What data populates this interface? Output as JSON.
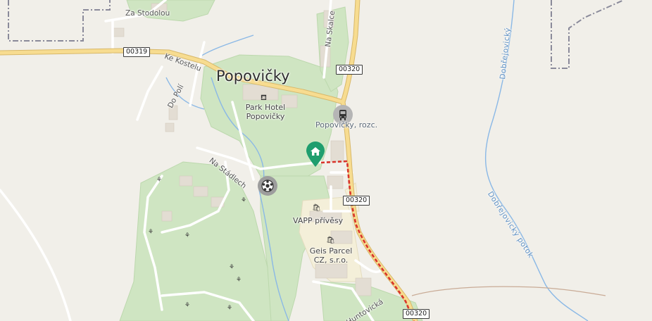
{
  "map": {
    "settlement": "Popovičky",
    "pois": {
      "hotel": "Park Hotel Popovičky",
      "bus_stop": "Popovičky, rozc.",
      "vapp": "VAPP přívěsy",
      "geis": "Geis Parcel CZ, s.r.o."
    },
    "streets": {
      "za_stodolou": "Za Stodolou",
      "ke_kostelu": "Ke Kostelu",
      "do_poli": "Do Polí",
      "na_stadlech": "Na Stádlech",
      "na_skalce": "Na Skalce",
      "huntovicka": "Huntovická"
    },
    "streams": {
      "dobrejovicky_potok": "Dobřejovický potok",
      "dobrejovicky_top": "Dobřejovický"
    },
    "road_shields": {
      "r00319": "00319",
      "r00320_top": "00320",
      "r00320_mid": "00320",
      "r00320_bottom": "00320"
    },
    "colors": {
      "background": "#f1efe9",
      "park": "#cfe5c2",
      "road_yellow": "#f5d98a",
      "route": "#d9342b",
      "water": "#8ab8e6",
      "marker": "#1f9e6e"
    }
  }
}
